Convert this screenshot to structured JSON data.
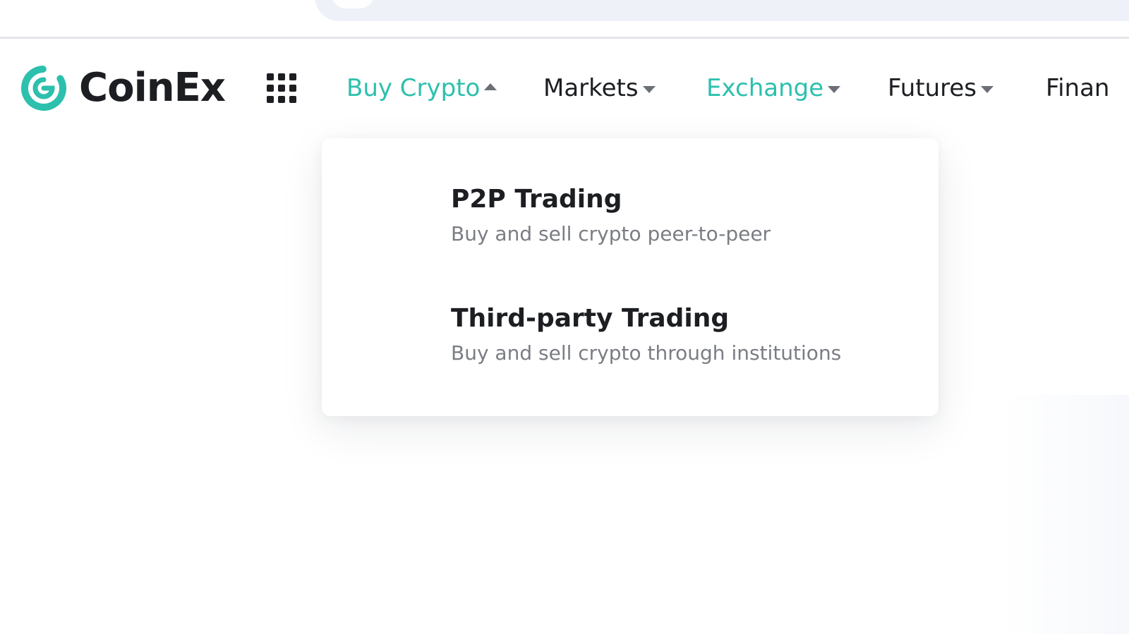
{
  "brand": {
    "name": "CoinEx",
    "accent_color": "#2cc0ad",
    "text_color": "#1c1e22"
  },
  "header": {
    "apps_icon": "grid-apps-icon",
    "nav": [
      {
        "label": "Buy Crypto",
        "active": true,
        "caret": "up"
      },
      {
        "label": "Markets",
        "active": false,
        "caret": "down"
      },
      {
        "label": "Exchange",
        "active": true,
        "caret": "down"
      },
      {
        "label": "Futures",
        "active": false,
        "caret": "down"
      },
      {
        "label": "Finan",
        "active": false,
        "caret": "none"
      }
    ]
  },
  "dropdown": {
    "items": [
      {
        "title": "P2P Trading",
        "description": "Buy and sell crypto peer-to-peer"
      },
      {
        "title": "Third-party Trading",
        "description": "Buy and sell crypto through institutions"
      }
    ]
  }
}
